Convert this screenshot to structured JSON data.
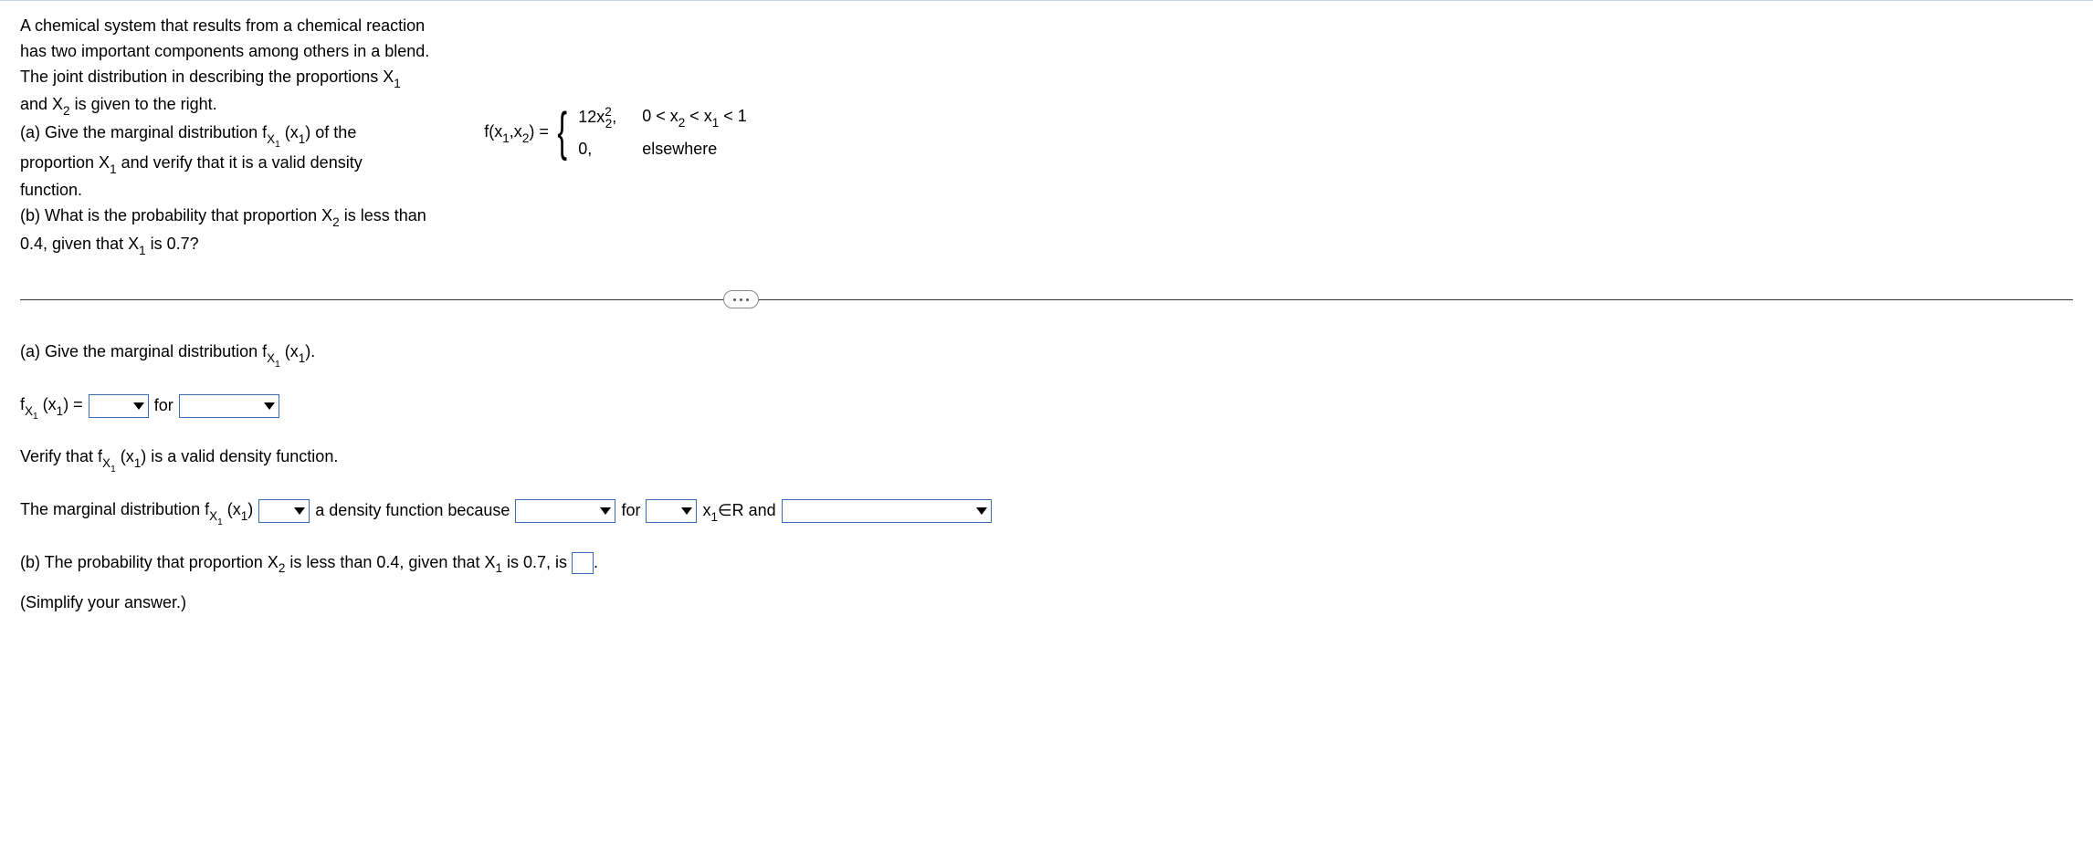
{
  "prompt": {
    "l1": "A chemical system that results from a chemical reaction",
    "l2": "has two important components among others in a blend.",
    "l3": "The joint distribution in describing the proportions X",
    "l3_sub": "1",
    "l4a": "and X",
    "l4_sub": "2",
    "l4b": " is given to the right.",
    "l5a": "(a) Give the marginal distribution f",
    "l5_sub1": "X",
    "l5_sub1b": "1",
    "l5b": "(x",
    "l5_sub2": "1",
    "l5c": ") of the",
    "l6a": "proportion X",
    "l6_sub": "1",
    "l6b": " and verify that it is a valid density",
    "l7": "function.",
    "l8a": "(b) What is the probability that proportion X",
    "l8_sub": "2",
    "l8b": " is less than",
    "l9a": "0.4, given that X",
    "l9_sub": "1",
    "l9b": " is 0.7?"
  },
  "formula": {
    "lhs_a": "f",
    "lhs_b": "(x",
    "lhs_s1": "1",
    "lhs_c": ",x",
    "lhs_s2": "2",
    "lhs_d": ") = ",
    "case1_a": "12x",
    "case1_sup": "2",
    "case1_sub": "2",
    "case1_b": ",",
    "case1_cond_a": "0 < x",
    "case1_cond_s1": "2",
    "case1_cond_b": " < x",
    "case1_cond_s2": "1",
    "case1_cond_c": " < 1",
    "case2_a": "0,",
    "case2_cond": "elsewhere"
  },
  "answers": {
    "a_heading_a": "(a) Give the marginal distribution f",
    "a_heading_b": "(x",
    "a_heading_c": ").",
    "fx_eq_a": "f",
    "fx_eq_b": "(x",
    "fx_eq_c": ") = ",
    "for_word": "for",
    "verify_a": "Verify that f",
    "verify_b": "(x",
    "verify_c": ") is a valid density function.",
    "marg_a": "The marginal distribution f",
    "marg_b": "(x",
    "marg_c": ")",
    "marg_d": "a density function because",
    "x1er_a": "x",
    "x1er_sub": "1",
    "x1er_b": "∈R and",
    "b_line_a": "(b) The probability that proportion X",
    "b_line_sub1": "2",
    "b_line_b": " is less than 0.4, given that X",
    "b_line_sub2": "1",
    "b_line_c": " is 0.7, is ",
    "b_line_d": ".",
    "simplify": "(Simplify your answer.)"
  }
}
